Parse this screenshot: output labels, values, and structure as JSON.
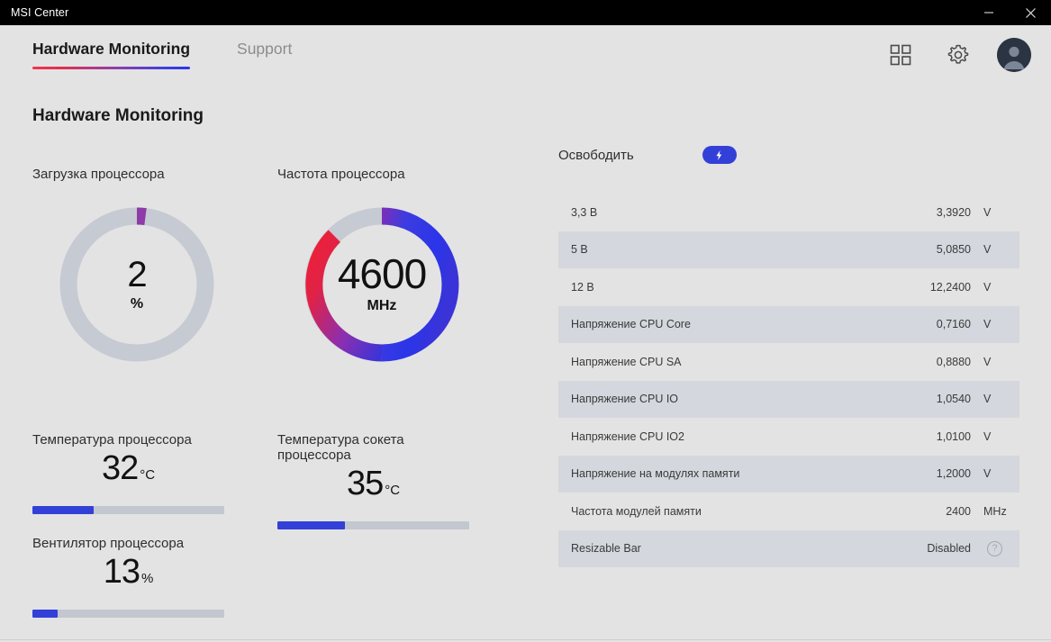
{
  "window": {
    "title": "MSI Center",
    "minimize_label": "minimize",
    "close_label": "close"
  },
  "nav": {
    "tabs": [
      {
        "label": "Hardware Monitoring",
        "active": true
      },
      {
        "label": "Support",
        "active": false
      }
    ],
    "actions": [
      {
        "name": "apps-grid-icon",
        "label": "Apps"
      },
      {
        "name": "gear-icon",
        "label": "Settings"
      },
      {
        "name": "avatar",
        "label": "Account"
      }
    ]
  },
  "page": {
    "title": "Hardware Monitoring"
  },
  "gauges": {
    "cpu_usage": {
      "label": "Загрузка процессора",
      "value": "2",
      "unit": "%",
      "percent": 2,
      "arc_color": "#8e3aa8",
      "track_color": "#c6cad2"
    },
    "cpu_frequency": {
      "label": "Частота процессора",
      "value": "4600",
      "unit": "MHz",
      "percent": 92,
      "gradient_from": "#2b35e8",
      "gradient_mid": "#8b2fb0",
      "gradient_to": "#ee2038",
      "track_color": "#c6cad2"
    }
  },
  "metrics": [
    {
      "name": "cpu-temperature",
      "title": "Температура процессора",
      "value": "32",
      "unit": "°C",
      "percent": 32
    },
    {
      "name": "cpu-socket-temperature",
      "title": "Температура сокета процессора",
      "value": "35",
      "unit": "°C",
      "percent": 35
    },
    {
      "name": "cpu-fan",
      "title": "Вентилятор процессора",
      "value": "13",
      "unit": "%",
      "percent": 13
    }
  ],
  "table": {
    "header_label": "Освободить",
    "toggle_state": "on",
    "toggle_icon": "lightning-bolt-icon",
    "rows": [
      {
        "name": "3,3 В",
        "value": "3,3920",
        "unit": "V"
      },
      {
        "name": "5 В",
        "value": "5,0850",
        "unit": "V"
      },
      {
        "name": "12 В",
        "value": "12,2400",
        "unit": "V"
      },
      {
        "name": "Напряжение CPU Core",
        "value": "0,7160",
        "unit": "V"
      },
      {
        "name": "Напряжение CPU SA",
        "value": "0,8880",
        "unit": "V"
      },
      {
        "name": "Напряжение CPU IO",
        "value": "1,0540",
        "unit": "V"
      },
      {
        "name": "Напряжение CPU IO2",
        "value": "1,0100",
        "unit": "V"
      },
      {
        "name": "Напряжение на модулях памяти",
        "value": "1,2000",
        "unit": "V"
      },
      {
        "name": "Частота модулей памяти",
        "value": "2400",
        "unit": "MHz"
      },
      {
        "name": "Resizable Bar",
        "value": "Disabled",
        "unit": "",
        "help": "?"
      }
    ]
  },
  "colors": {
    "background": "#e3e3e3",
    "titlebar": "#000000",
    "accent_blue": "#3340d8",
    "accent_red": "#ee2038",
    "row_alt": "#d4d7dd",
    "track": "#c3c7cf"
  }
}
